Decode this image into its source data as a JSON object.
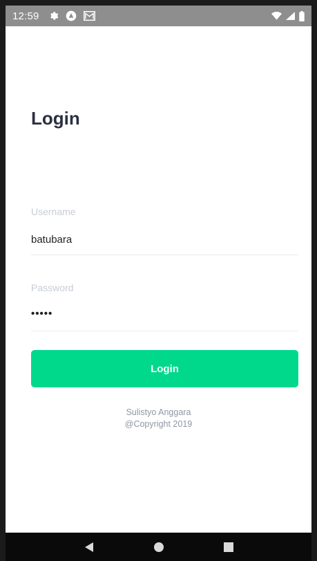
{
  "status_bar": {
    "time": "12:59",
    "icons_left": [
      "gear-icon",
      "app-icon",
      "mail-icon"
    ],
    "icons_right": [
      "wifi-icon",
      "signal-icon",
      "battery-icon"
    ]
  },
  "page": {
    "title": "Login"
  },
  "form": {
    "username_label": "Username",
    "username_value": "batubara",
    "password_label": "Password",
    "password_value": "•••••",
    "login_label": "Login"
  },
  "footer": {
    "author": "Sulistyo Anggara",
    "copyright": "@Copyright 2019"
  },
  "nav": {
    "icons": [
      "back-icon",
      "home-icon",
      "recents-icon"
    ]
  },
  "colors": {
    "accent": "#00d98b",
    "title": "#2b3040",
    "label": "#c7ccd6",
    "footer": "#8f96a3",
    "status_bar": "#8e8e8e"
  }
}
